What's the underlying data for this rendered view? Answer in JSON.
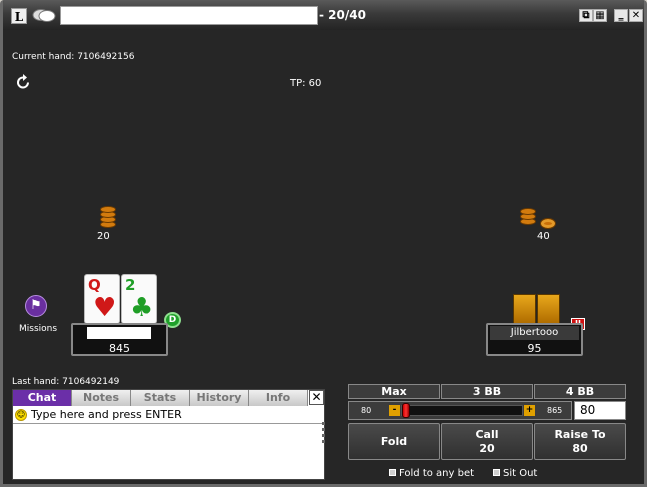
{
  "window": {
    "logo_letter": "L",
    "stakes": "- 20/40",
    "controls": [
      "restore",
      "tile",
      "minimize",
      "close"
    ]
  },
  "table": {
    "current_hand": "Current hand: 7106492156",
    "total_pot": "TP: 60",
    "last_hand": "Last hand: 7106492149",
    "missions_label": "Missions",
    "hero_bet": "20",
    "villain_bet": "40"
  },
  "hero": {
    "name": "",
    "stack": "845",
    "cards": [
      {
        "rank": "Q",
        "suit": "♥",
        "color": "#d01818"
      },
      {
        "rank": "2",
        "suit": "♣",
        "color": "#1f9e26"
      }
    ],
    "dealer_label": "D"
  },
  "villain": {
    "name": "Jilbertooo",
    "stack": "95",
    "status_badge": "II"
  },
  "chat": {
    "tabs": [
      "Chat",
      "Notes",
      "Stats",
      "History",
      "Info"
    ],
    "active_tab": "Chat",
    "placeholder": "Type here and press ENTER",
    "close_label": "✕"
  },
  "bet_panel": {
    "presets": [
      "Max",
      "3 BB",
      "4 BB"
    ],
    "slider_min": "80",
    "slider_max": "865",
    "slider_value": 80,
    "amount": "80",
    "minus_label": "-",
    "plus_label": "+",
    "fold_label": "Fold",
    "call_label": "Call",
    "call_amount": "20",
    "raise_label": "Raise To",
    "raise_amount": "80",
    "fold_any_label": "Fold to any bet",
    "sit_out_label": "Sit Out"
  }
}
